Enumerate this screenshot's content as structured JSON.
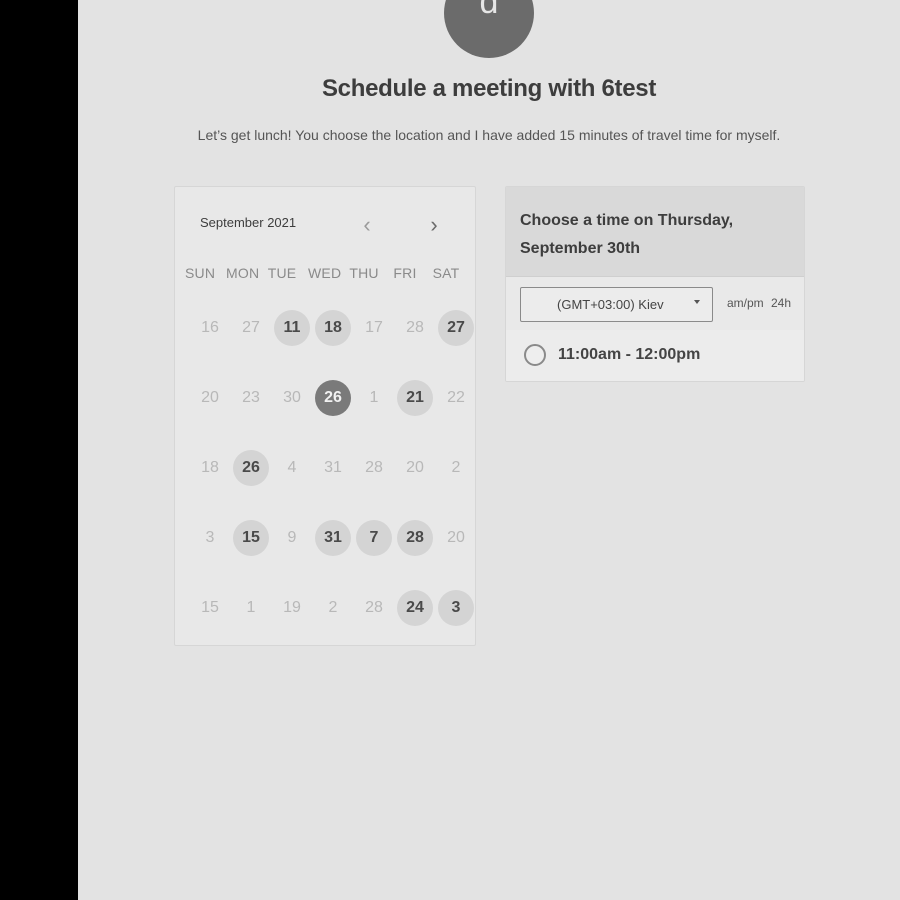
{
  "host": {
    "avatar_letter": "d",
    "title": "Schedule a meeting with 6test",
    "description": "Let’s get lunch! You choose the location and I have added 15 minutes of travel time for myself."
  },
  "calendar": {
    "month_label": "September 2021",
    "prev_icon": "‹",
    "next_icon": "›",
    "weekdays": [
      "SUN",
      "MON",
      "TUE",
      "WED",
      "THU",
      "FRI",
      "SAT"
    ],
    "weeks": [
      [
        {
          "d": "16",
          "s": "off"
        },
        {
          "d": "27",
          "s": "off"
        },
        {
          "d": "11",
          "s": "on"
        },
        {
          "d": "18",
          "s": "on"
        },
        {
          "d": "17",
          "s": "off"
        },
        {
          "d": "28",
          "s": "off"
        },
        {
          "d": "27",
          "s": "on"
        }
      ],
      [
        {
          "d": "20",
          "s": "off"
        },
        {
          "d": "23",
          "s": "off"
        },
        {
          "d": "30",
          "s": "off"
        },
        {
          "d": "26",
          "s": "sel"
        },
        {
          "d": "1",
          "s": "off"
        },
        {
          "d": "21",
          "s": "on"
        },
        {
          "d": "22",
          "s": "off"
        }
      ],
      [
        {
          "d": "18",
          "s": "off"
        },
        {
          "d": "26",
          "s": "on"
        },
        {
          "d": "4",
          "s": "off"
        },
        {
          "d": "31",
          "s": "off"
        },
        {
          "d": "28",
          "s": "off"
        },
        {
          "d": "20",
          "s": "off"
        },
        {
          "d": "2",
          "s": "off"
        }
      ],
      [
        {
          "d": "3",
          "s": "off"
        },
        {
          "d": "15",
          "s": "on"
        },
        {
          "d": "9",
          "s": "off"
        },
        {
          "d": "31",
          "s": "on"
        },
        {
          "d": "7",
          "s": "on"
        },
        {
          "d": "28",
          "s": "on"
        },
        {
          "d": "20",
          "s": "off"
        }
      ],
      [
        {
          "d": "15",
          "s": "off"
        },
        {
          "d": "1",
          "s": "off"
        },
        {
          "d": "19",
          "s": "off"
        },
        {
          "d": "2",
          "s": "off"
        },
        {
          "d": "28",
          "s": "off"
        },
        {
          "d": "24",
          "s": "on"
        },
        {
          "d": "3",
          "s": "on"
        }
      ]
    ]
  },
  "times": {
    "heading": "Choose a time on Thursday, September 30th",
    "timezone": "(GMT+03:00) Kiev",
    "format_ampm": "am/pm",
    "format_24h": "24h",
    "slots": [
      "11:00am - 12:00pm"
    ]
  },
  "colors": {
    "page_bg": "#e3e3e3",
    "selected_day": "#7a7a7a",
    "available_day": "#d4d4d4"
  }
}
